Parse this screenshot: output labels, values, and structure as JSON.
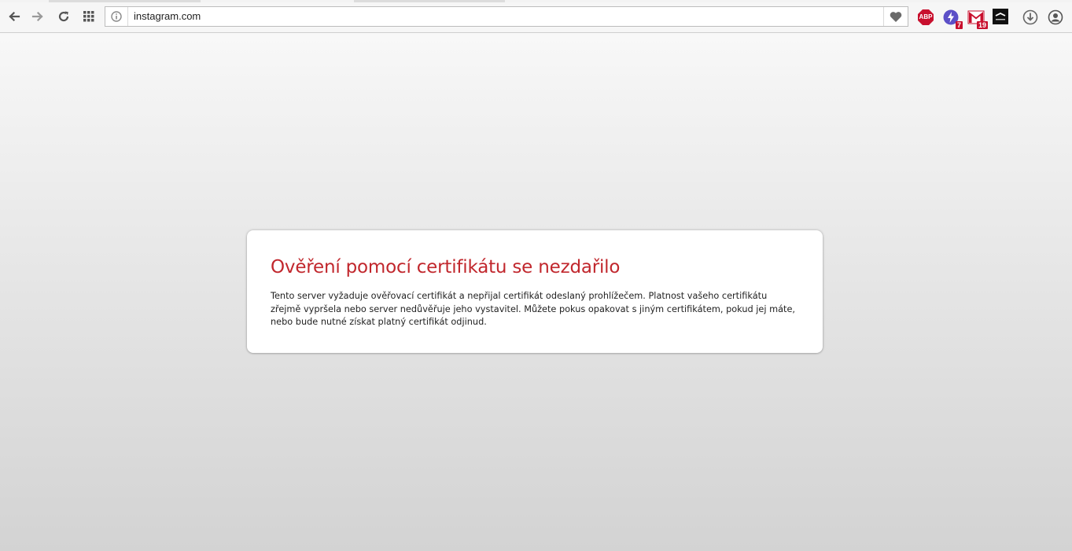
{
  "browser": {
    "address_bar": {
      "url": "instagram.com"
    },
    "toolbar": {
      "back_icon": "back-arrow-icon",
      "forward_icon": "forward-arrow-icon",
      "reload_icon": "reload-icon",
      "speed_dial_icon": "grid-icon",
      "info_icon": "info-icon",
      "heart_icon": "heart-icon",
      "download_icon": "download-icon",
      "profile_icon": "profile-icon"
    },
    "extensions": [
      {
        "name": "adblock-plus",
        "label": "ABP",
        "color": "#c8102e"
      },
      {
        "name": "notifier",
        "badge": "7",
        "color": "#5b4fc7"
      },
      {
        "name": "gmail",
        "label": "M",
        "badge": "19",
        "color": "#c8102e"
      },
      {
        "name": "steam",
        "color": "#111111"
      }
    ]
  },
  "error": {
    "title": "Ověření pomocí certifikátu se nezdařilo",
    "message": "Tento server vyžaduje ověřovací certifikát a nepřijal certifikát odeslaný prohlížečem. Platnost vašeho certifikátu zřejmě vypršela nebo server nedůvěřuje jeho vystavitel. Můžete pokus opakovat s jiným certifikátem, pokud jej máte, nebo bude nutné získat platný certifikát odjinud.",
    "title_color": "#c1272d"
  }
}
